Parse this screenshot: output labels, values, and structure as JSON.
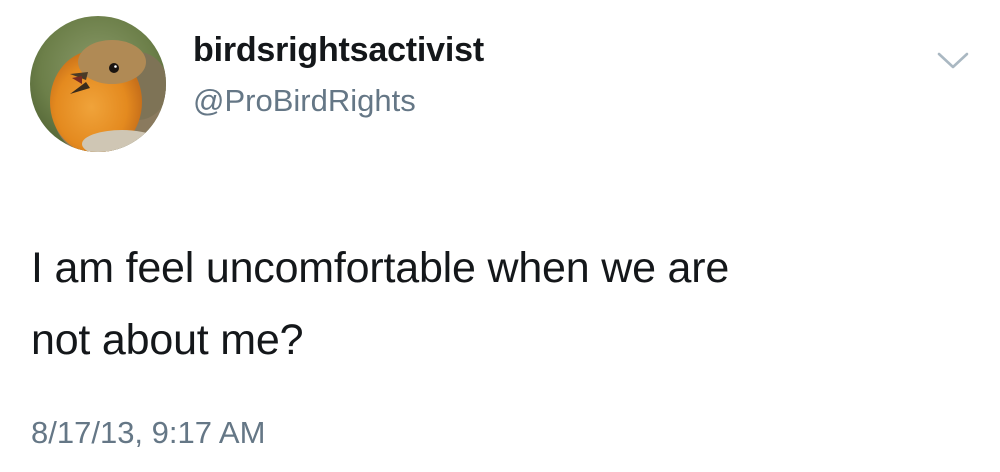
{
  "tweet": {
    "author": {
      "display_name": "birdsrightsactivist",
      "handle": "@ProBirdRights",
      "avatar_icon": "robin-avatar"
    },
    "text_lines": [
      "I am feel uncomfortable when we are",
      "not about me?"
    ],
    "timestamp": "8/17/13, 9:17 AM",
    "menu_icon": "chevron-down-icon"
  },
  "colors": {
    "text": "#14171a",
    "secondary_text": "#657786",
    "chevron": "#aab8c2"
  }
}
